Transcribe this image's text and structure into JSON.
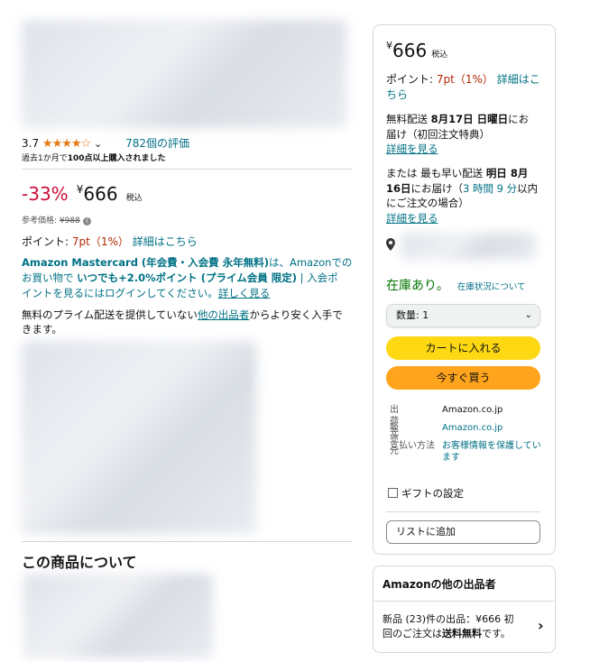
{
  "rating": {
    "value": "3.7",
    "stars": "★★★★☆",
    "reviews": "782個の評価",
    "recent_purchase_prefix": "過去1か月で",
    "recent_purchase_bold": "100点以上購入されました"
  },
  "price": {
    "discount": "-33%",
    "currency": "¥",
    "value": "666",
    "tax": "税込",
    "ref_label": "参考価格:",
    "ref_value": "¥988"
  },
  "points": {
    "label": "ポイント:",
    "value": "7pt（1%）",
    "detail_link": "詳細はこちら"
  },
  "card_offer": {
    "line1_bold": "Amazon Mastercard (年会費・入会費 永年無料)",
    "line1_rest": "は、Amazonでの",
    "line2_a": "お買い物で ",
    "line2_bold": "いつでも+2.0%ポイント (プライム会員 限定)",
    "line2_rest": " | 入会ポ",
    "line3": "イントを見るにはログインしてください。",
    "line3_link": "詳しく見る"
  },
  "prime_note": {
    "prefix": "無料のプライム配送を提供していない",
    "link": "他の出品者",
    "suffix": "からより安く入手で",
    "line2": "きます。"
  },
  "about_title": "この商品について",
  "buybox": {
    "currency": "¥",
    "price": "666",
    "tax": "税込",
    "points_label": "ポイント: ",
    "points_value": "7pt（1%）",
    "points_link1": "詳細はこ",
    "points_link2": "ちら",
    "delivery1_a": "無料配送 ",
    "delivery1_bold": "8月17日 日曜日",
    "delivery1_b": "にお",
    "delivery1_line2": "届け（初回注文特典）",
    "delivery1_link": "詳細を見る",
    "fast_a": "または 最も早い配送 ",
    "fast_bold": "明日 8月",
    "fast_line2_bold": "16日",
    "fast_line2_a": "にお届け（",
    "fast_time": "3 時間 9 分",
    "fast_line2_b": "以内",
    "fast_line3": "にご注文の場合）",
    "fast_link": "詳細を見る",
    "stock": "在庫あり。",
    "stock_link": "在庫状況について",
    "qty": "数量: 1",
    "add_to_cart": "カートに入れる",
    "buy_now": "今すぐ買う",
    "ships_from_label": "出荷元",
    "ships_from": "Amazon.co.jp",
    "sold_by_label": "販売元",
    "sold_by": "Amazon.co.jp",
    "payment_label": "支払い方法",
    "payment_line1": "お客様情報を保護してい",
    "payment_line2": "ます",
    "gift": "ギフトの設定",
    "list": "リストに追加"
  },
  "other_sellers": {
    "title": "Amazonの他の出品者",
    "line1_a": "新品 (23)件の出品：",
    "line1_price": "¥666",
    "line1_b": " 初",
    "line2_a": "回のご注文は",
    "line2_bold": "送料無料",
    "line2_b": "です。"
  },
  "colors": {
    "button_cart": "#ffd814",
    "button_buy": "#ffa41c",
    "link": "#007185",
    "price_red": "#cc0c39",
    "stock_green": "#007600"
  }
}
